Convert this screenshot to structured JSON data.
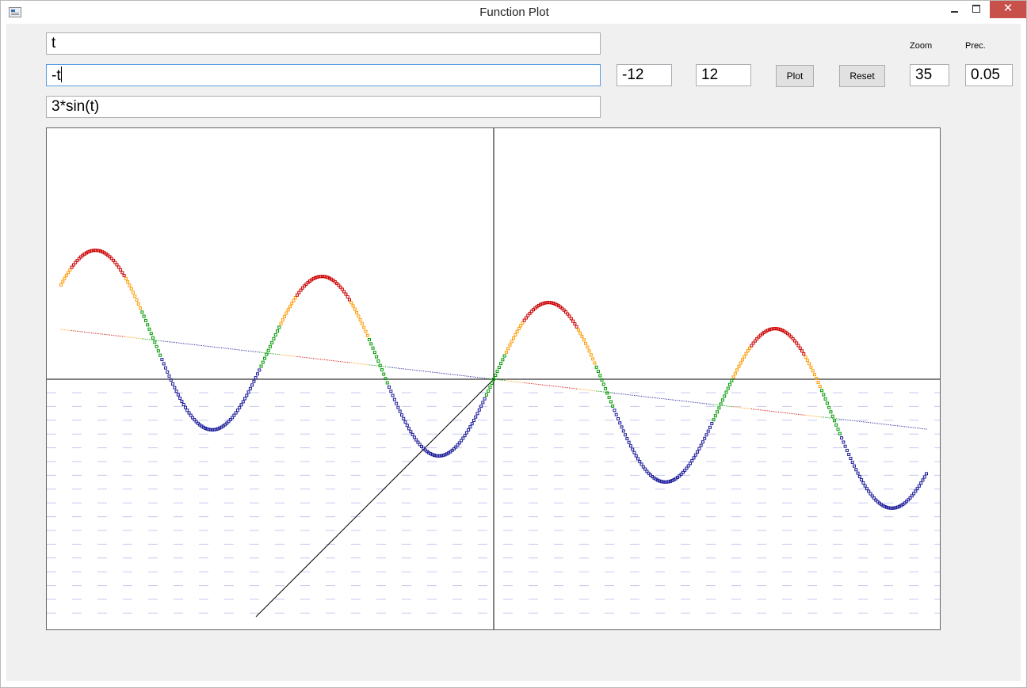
{
  "window": {
    "title": "Function Plot",
    "close_glyph": "✕"
  },
  "inputs": {
    "x_expr": "t",
    "y_expr": "-t",
    "z_expr": "3*sin(t)",
    "t_min": "-12",
    "t_max": "12",
    "zoom_label": "Zoom",
    "zoom": "35",
    "prec_label": "Prec.",
    "prec": "0.05"
  },
  "buttons": {
    "plot": "Plot",
    "reset": "Reset"
  },
  "icons": [
    "app-icon",
    "minimize-icon",
    "maximize-icon",
    "close-icon"
  ],
  "colors": {
    "axis": "#000000",
    "grid_dash": "#c8c8f0",
    "high": "#cc0000",
    "mid_high": "#ff9900",
    "zero": "#009900",
    "low": "#1a1a99",
    "low_edge": "#333333"
  },
  "chart_data": {
    "type": "scatter",
    "curve": {
      "x": "t",
      "y": "-t",
      "z": "3*sin(t)"
    },
    "t_range": [
      -12,
      12
    ],
    "t_step": 0.05,
    "zoom": 35,
    "projection": "oblique 3D (x right, y diagonal, z up)",
    "grid": "horizontal dashed lines below x-axis",
    "point_color_by_z": [
      "red (high)",
      "orange",
      "green (near 0)",
      "blue (low)"
    ]
  }
}
